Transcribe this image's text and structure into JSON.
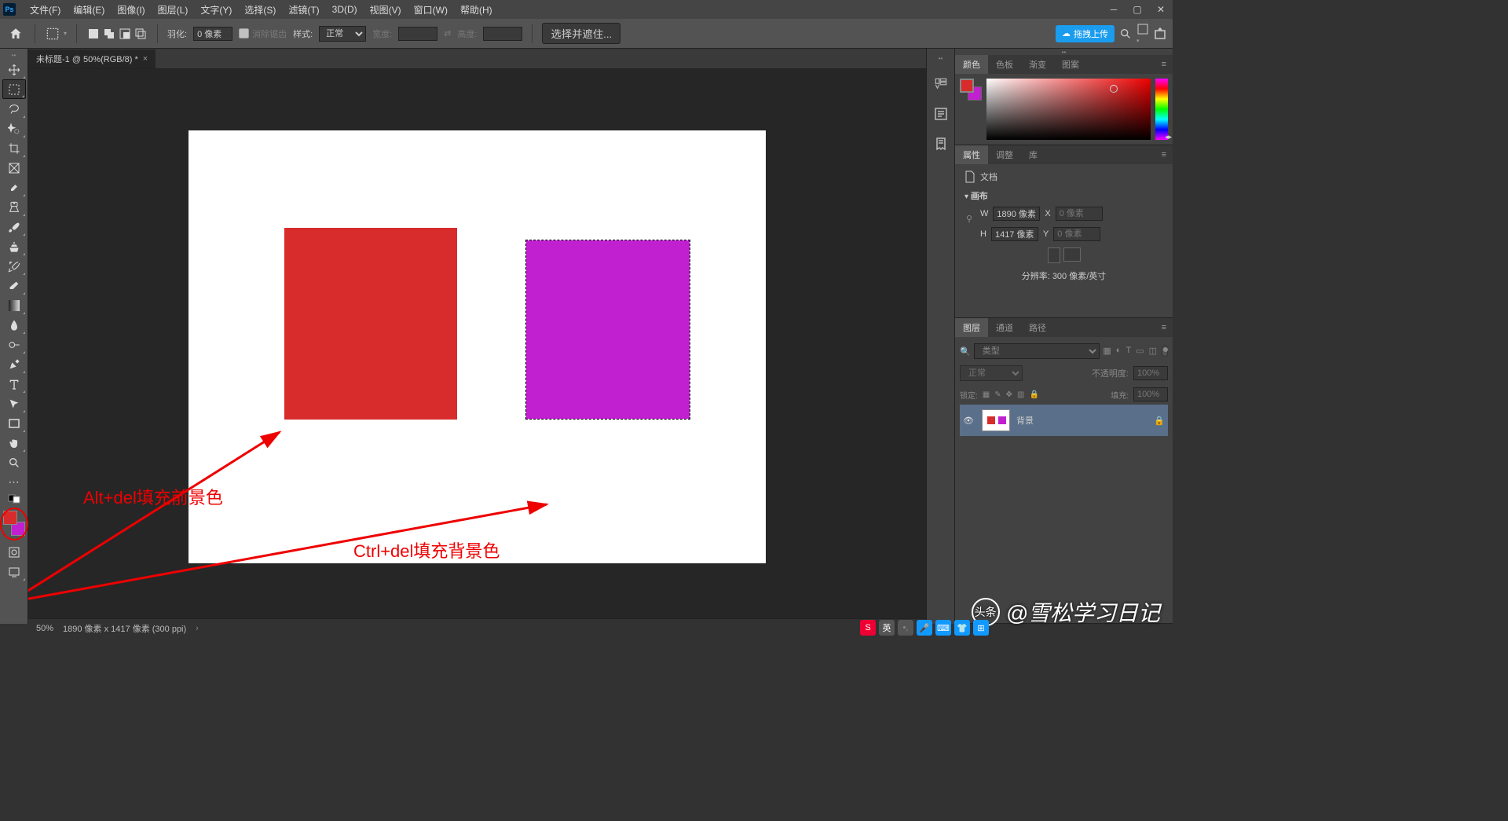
{
  "menu": {
    "items": [
      "文件(F)",
      "编辑(E)",
      "图像(I)",
      "图层(L)",
      "文字(Y)",
      "选择(S)",
      "滤镜(T)",
      "3D(D)",
      "视图(V)",
      "窗口(W)",
      "帮助(H)"
    ]
  },
  "options": {
    "feather_label": "羽化:",
    "feather_value": "0 像素",
    "antialias": "消除锯齿",
    "style_label": "样式:",
    "style_value": "正常",
    "width_label": "宽度:",
    "height_label": "高度:",
    "select_mask": "选择并遮住...",
    "upload": "拖拽上传"
  },
  "doc_tab": "未标题-1 @ 50%(RGB/8) *",
  "annotations": {
    "fg": "Alt+del填充前景色",
    "bg": "Ctrl+del填充背景色"
  },
  "panels": {
    "color_tabs": [
      "颜色",
      "色板",
      "渐变",
      "图案"
    ],
    "props_tabs": [
      "属性",
      "调整",
      "库"
    ],
    "props_doc": "文档",
    "canvas_section": "画布",
    "w_label": "W",
    "w_value": "1890 像素",
    "h_label": "H",
    "h_value": "1417 像素",
    "x_label": "X",
    "x_placeholder": "0 像素",
    "y_label": "Y",
    "y_placeholder": "0 像素",
    "resolution": "分辨率: 300 像素/英寸",
    "layers_tabs": [
      "图层",
      "通道",
      "路径"
    ],
    "filter_placeholder": "类型",
    "blend_mode": "正常",
    "opacity_label": "不透明度:",
    "opacity_value": "100%",
    "lock_label": "锁定:",
    "fill_label": "填充:",
    "fill_value": "100%",
    "layer_name": "背景"
  },
  "status": {
    "zoom": "50%",
    "dims": "1890 像素 x 1417 像素 (300 ppi)"
  },
  "watermark": {
    "prefix": "头条",
    "text": "@雪松学习日记"
  },
  "colors": {
    "foreground": "#d82c2c",
    "background": "#c020d0"
  }
}
